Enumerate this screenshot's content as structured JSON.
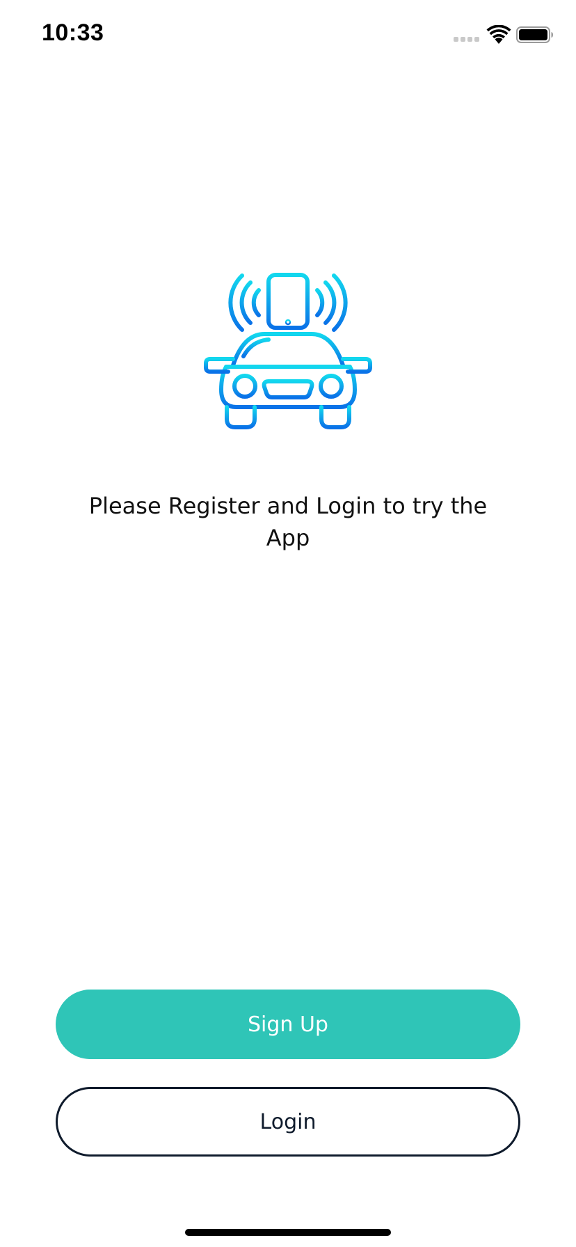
{
  "status_bar": {
    "time": "10:33",
    "icons": [
      "signal-icon",
      "wifi-icon",
      "battery-icon"
    ]
  },
  "hero": {
    "icon": "car-phone-connected-icon",
    "gradient_colors": [
      "#12d7ee",
      "#0a72e8"
    ]
  },
  "prompt": {
    "text": "Please Register and Login to try the App"
  },
  "actions": {
    "signup_label": "Sign Up",
    "login_label": "Login"
  },
  "colors": {
    "signup_bg": "#2fc5b7",
    "login_border": "#0f1b2c",
    "text": "#111111"
  }
}
